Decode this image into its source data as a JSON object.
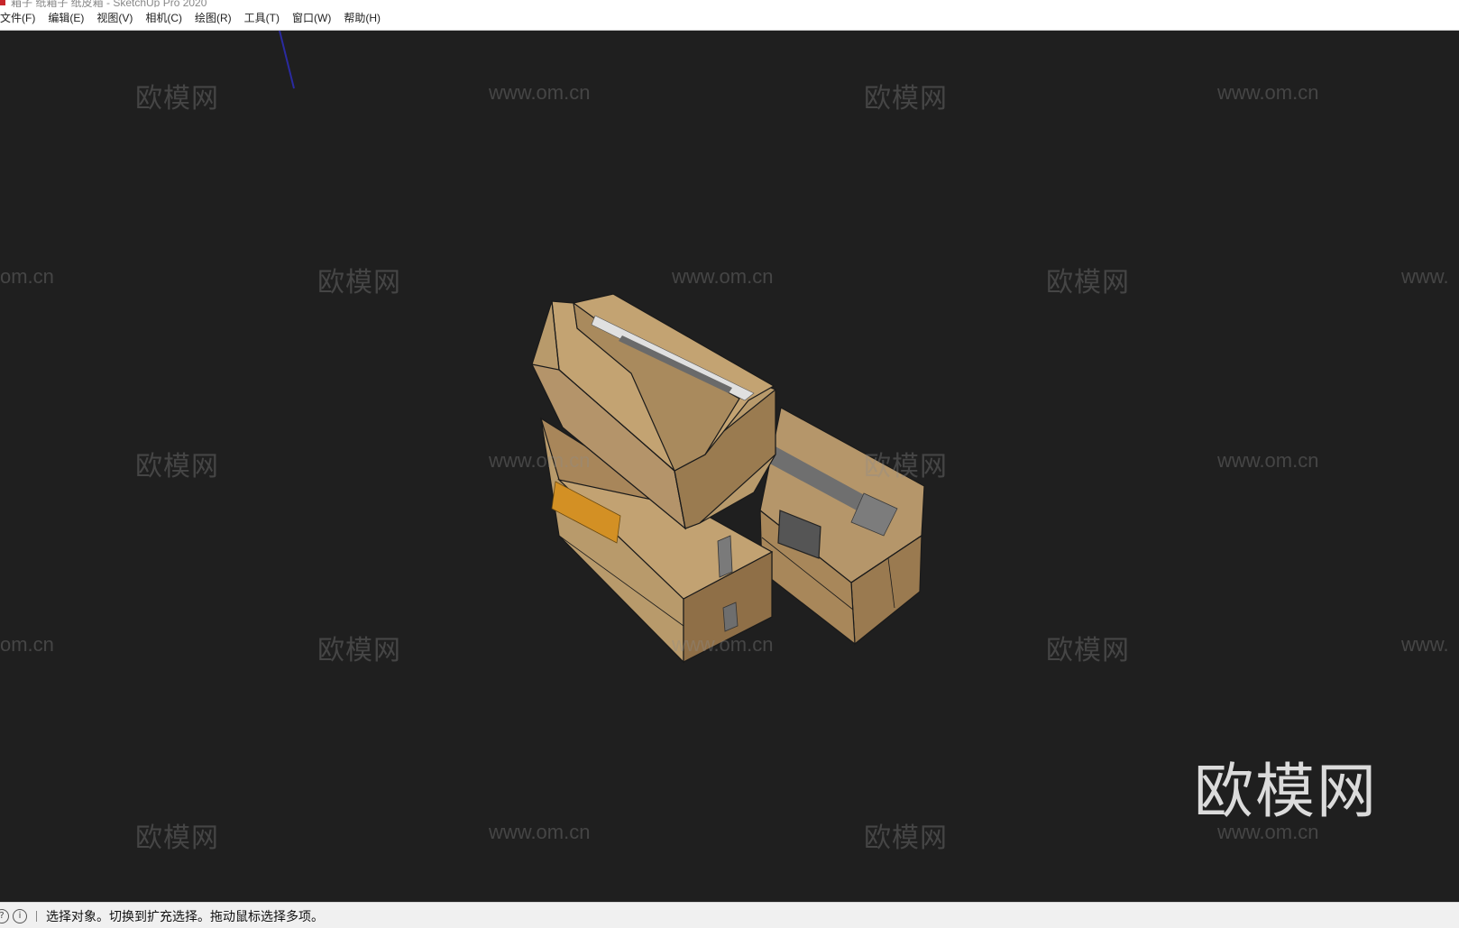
{
  "window": {
    "title": "箱子 纸箱子 纸皮箱 - SketchUp Pro 2020"
  },
  "menubar": {
    "items": [
      {
        "label": "文件(F)"
      },
      {
        "label": "编辑(E)"
      },
      {
        "label": "视图(V)"
      },
      {
        "label": "相机(C)"
      },
      {
        "label": "绘图(R)"
      },
      {
        "label": "工具(T)"
      },
      {
        "label": "窗口(W)"
      },
      {
        "label": "帮助(H)"
      }
    ]
  },
  "watermarks": {
    "cn": "欧模网",
    "url": "www.om.cn",
    "url_partial_left": "om.cn",
    "url_partial_right": "www.",
    "big_logo": "欧模网"
  },
  "statusbar": {
    "icons": [
      "geo-location-icon",
      "info-icon"
    ],
    "message": "选择对象。切换到扩充选择。拖动鼠标选择多项。"
  },
  "colors": {
    "viewport_bg": "#1f1f1f",
    "cardboard": "#b08f62",
    "cardboard_light": "#c4a574",
    "cardboard_dark": "#8e7049",
    "tape": "#8a8a8a",
    "label_orange": "#d89a2a",
    "axis_blue": "#2a2aa0"
  }
}
